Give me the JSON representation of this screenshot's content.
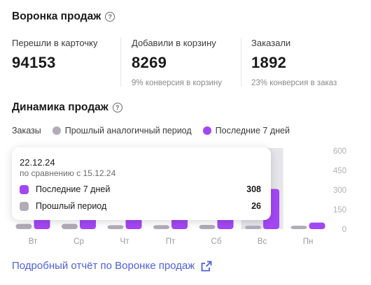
{
  "funnel": {
    "title": "Воронка продаж",
    "metrics": [
      {
        "label": "Перешли в карточку",
        "value": "94153",
        "sub": ""
      },
      {
        "label": "Добавили в корзину",
        "value": "8269",
        "sub": "9% конверсия в корзину"
      },
      {
        "label": "Заказали",
        "value": "1892",
        "sub": "23% конверсия в заказ"
      }
    ]
  },
  "dynamics": {
    "title": "Динамика продаж",
    "legend": {
      "label": "Заказы",
      "prev": "Прошлый аналогичный период",
      "current": "Последние 7 дней"
    }
  },
  "colors": {
    "current": "#a347f4",
    "prev": "#b2abb8",
    "hover": "#e6e6ea",
    "link": "#4f5fd9"
  },
  "tooltip": {
    "date": "22.12.24",
    "compare": "по сравнению с 15.12.24",
    "rows": [
      {
        "label": "Последние 7 дней",
        "value": "308"
      },
      {
        "label": "Прошлый период",
        "value": "26"
      }
    ]
  },
  "chart_data": {
    "type": "bar",
    "categories": [
      "Вт",
      "Ср",
      "Чт",
      "Пт",
      "Сб",
      "Вс",
      "Пн"
    ],
    "series": [
      {
        "name": "Прошлый аналогичный период",
        "values": [
          40,
          40,
          30,
          30,
          32,
          26,
          26
        ]
      },
      {
        "name": "Последние 7 дней",
        "values": [
          100,
          100,
          100,
          95,
          110,
          308,
          50
        ]
      }
    ],
    "yticks": [
      "600",
      "450",
      "300",
      "150",
      "0"
    ],
    "ylim": [
      0,
      600
    ],
    "highlight_index": 5
  },
  "report_link": {
    "label": "Подробный отчёт по Воронке продаж"
  }
}
